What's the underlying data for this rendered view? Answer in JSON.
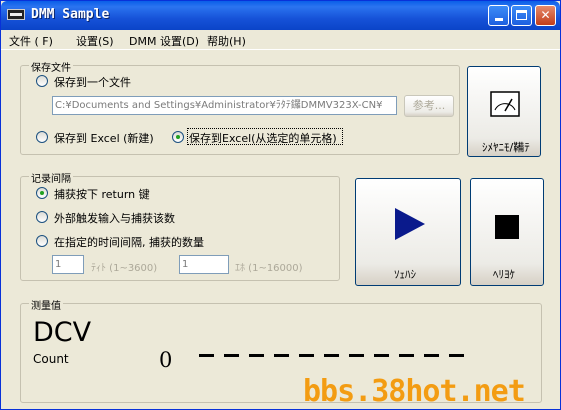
{
  "window": {
    "title": "DMM Sample"
  },
  "menu": [
    {
      "label": "文件 ( F)"
    },
    {
      "label": "设置(S)"
    },
    {
      "label": "DMM 设置(D)"
    },
    {
      "label": "帮助(H)"
    }
  ],
  "save_group": {
    "label": "保存文件",
    "option_file": "保存到一个文件",
    "file_path": "C:¥Documents and Settings¥Administrator¥ﾗﾀﾃ鑼DMMV323X-CN¥",
    "browse_button": "参考...",
    "option_excel_new": "保存到 Excel (新建)",
    "option_excel_cell": "保存到Excel(从选定的单元格)",
    "selected": "option_excel_cell"
  },
  "monitor_button": {
    "label": "ｼﾒﾔﾆﾓ/鞴ﾃ",
    "icon": "meter-icon"
  },
  "interval_group": {
    "label": "记录间隔",
    "option_return": "捕获按下 return 键",
    "option_external": "外部触发输入与捕获该数",
    "option_timed": "在指定的时间间隔, 捕获的数量",
    "interval_value": "1",
    "interval_hint": "ﾃｨﾄ (1~3600)",
    "count_value": "1",
    "count_hint": "ｴﾎ (1~16000)",
    "selected": "option_return"
  },
  "start_button": {
    "label": "ｿｪﾊｼ",
    "icon": "play-icon",
    "color": "#0a1a8c"
  },
  "stop_button": {
    "label": "ﾍﾘﾖｹ",
    "icon": "stop-icon"
  },
  "measure_group": {
    "label": "测量值",
    "unit": "DCV",
    "count_label": "Count",
    "count_value": "0",
    "display_segments": 11
  },
  "watermark": "bbs.38hot.net"
}
